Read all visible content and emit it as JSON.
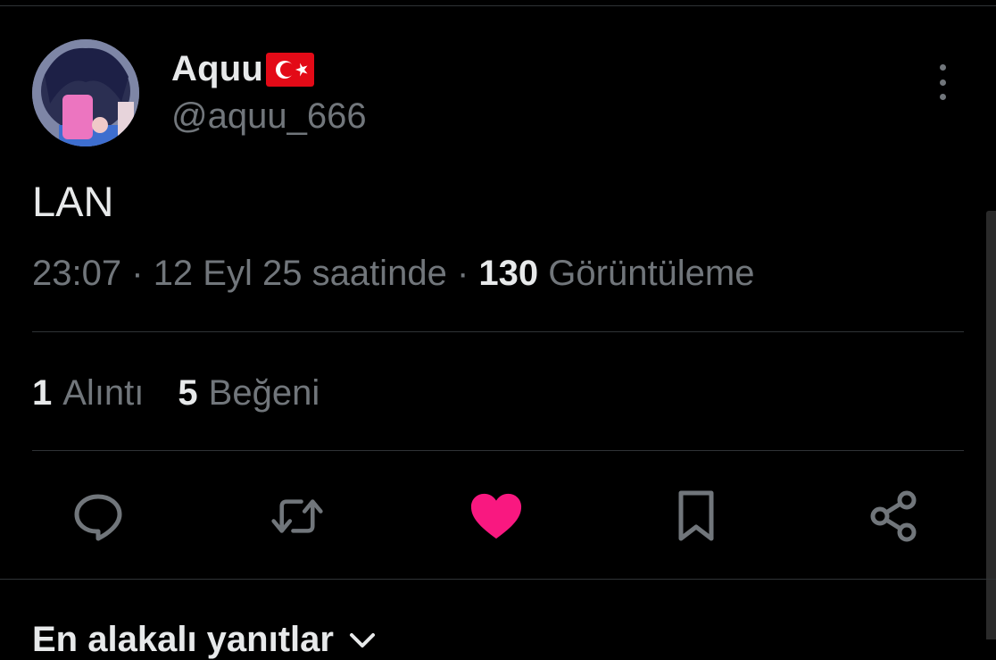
{
  "author": {
    "display_name": "Aquu",
    "flag_emoji_name": "turkey-flag-icon",
    "handle": "@aquu_666"
  },
  "tweet": {
    "text": "LAN",
    "time": "23:07",
    "separator": "·",
    "date": "12 Eyl 25 saatinde",
    "views_count": "130",
    "views_label": "Görüntüleme"
  },
  "stats": {
    "quotes_count": "1",
    "quotes_label": "Alıntı",
    "likes_count": "5",
    "likes_label": "Beğeni"
  },
  "replies": {
    "header": "En alakalı yanıtlar"
  },
  "colors": {
    "background": "#000000",
    "primary_text": "#e7e9ea",
    "secondary_text": "#71767b",
    "divider": "#2f3336",
    "like_active": "#f91880",
    "flag_red": "#e30a17"
  },
  "icons": [
    "reply-icon",
    "retweet-icon",
    "like-icon",
    "bookmark-icon",
    "share-icon",
    "more-options-icon"
  ]
}
